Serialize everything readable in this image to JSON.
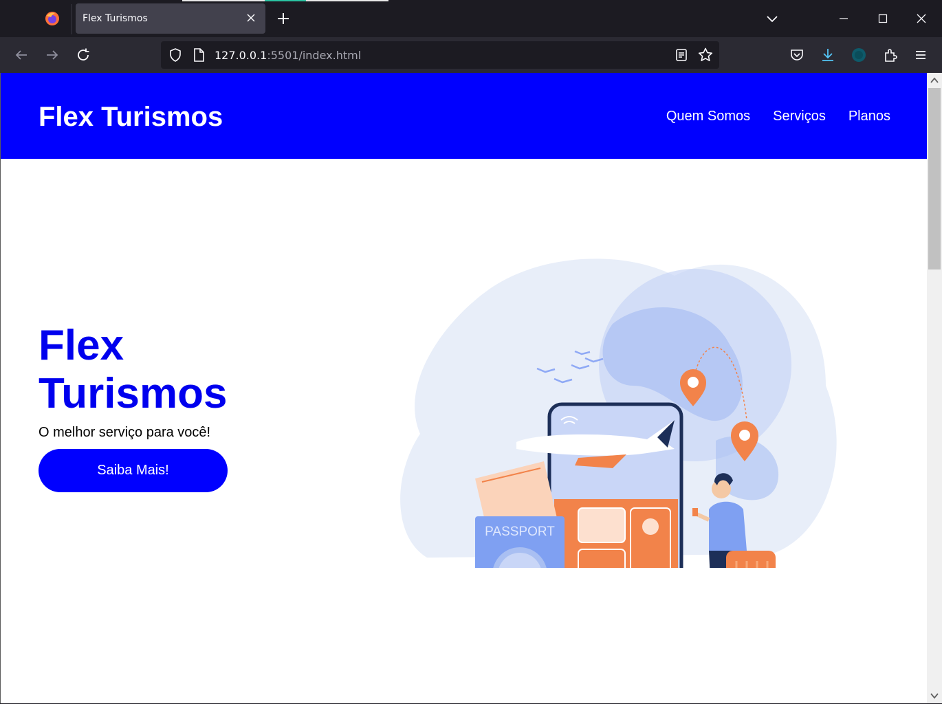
{
  "browser": {
    "tab_title": "Flex Turismos",
    "url_host": "127.0.0.1",
    "url_rest": ":5501/index.html"
  },
  "header": {
    "brand": "Flex Turismos",
    "nav": [
      "Quem Somos",
      "Serviços",
      "Planos"
    ]
  },
  "hero": {
    "title": "Flex Turismos",
    "subtitle": "O melhor serviço para você!",
    "button_label": "Saiba Mais!"
  },
  "illustration": {
    "passport_label": "PASSPORT"
  },
  "colors": {
    "brand_blue": "#0000ff",
    "hero_title": "#0000ee",
    "illustration_orange": "#f2834a",
    "illustration_blue": "#8fa9f5"
  }
}
